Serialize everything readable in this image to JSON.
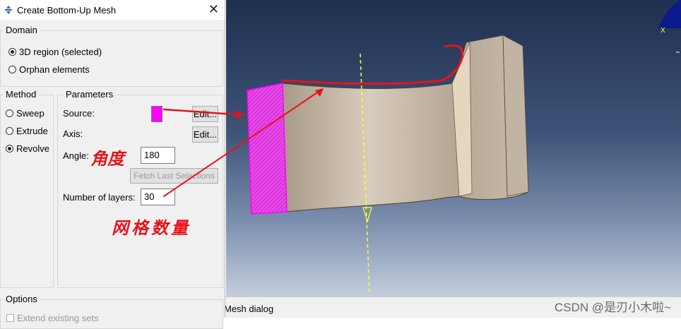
{
  "dialog": {
    "title": "Create Bottom-Up Mesh",
    "close_glyph": "✕",
    "domain": {
      "label": "Domain",
      "options": [
        "3D region (selected)",
        "Orphan elements"
      ],
      "selected": 0
    },
    "method": {
      "label": "Method",
      "options": [
        "Sweep",
        "Extrude",
        "Revolve"
      ],
      "selected": 2
    },
    "parameters": {
      "label": "Parameters",
      "source_label": "Source:",
      "source_color": "#ff00ff",
      "source_edit": "Edit...",
      "axis_label": "Axis:",
      "axis_edit": "Edit...",
      "angle_label": "Angle:",
      "angle_value": "180",
      "fetch_button": "Fetch Last Selections",
      "layers_label": "Number of layers:",
      "layers_value": "30"
    },
    "options": {
      "label": "Options",
      "extend_label": "Extend existing sets"
    }
  },
  "annotations": {
    "angle": "角度",
    "layers": "网格数量",
    "color": "#e8121a"
  },
  "status": {
    "message": "Mesh dialog",
    "watermark": "CSDN @是刃小木啦~"
  },
  "viewport": {
    "triad_x_label": "X"
  }
}
